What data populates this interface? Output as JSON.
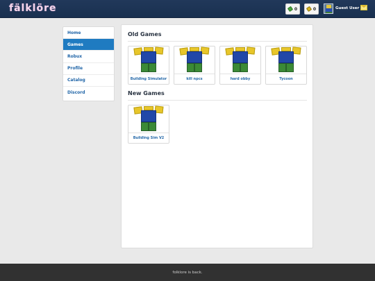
{
  "header": {
    "logo": "fälklöre",
    "robux_count": "0",
    "tix_count": "0",
    "username": "Guest User"
  },
  "sidebar": {
    "items": [
      {
        "label": "Home"
      },
      {
        "label": "Games"
      },
      {
        "label": "Robux"
      },
      {
        "label": "Profile"
      },
      {
        "label": "Catalog"
      },
      {
        "label": "Discord"
      }
    ]
  },
  "main": {
    "old_games_title": "Old Games",
    "old_games": [
      {
        "name": "Building Simulator"
      },
      {
        "name": "kill npcs"
      },
      {
        "name": "hard obby"
      },
      {
        "name": "Tycoon"
      }
    ],
    "new_games_title": "New Games",
    "new_games": [
      {
        "name": "Building Sim V2"
      }
    ]
  },
  "footer": {
    "text": "folklore is back."
  },
  "colors": {
    "header_bg": "#1c3354",
    "active_nav": "#1f7bc1",
    "link": "#2266a8",
    "footer_bg": "#313131"
  }
}
